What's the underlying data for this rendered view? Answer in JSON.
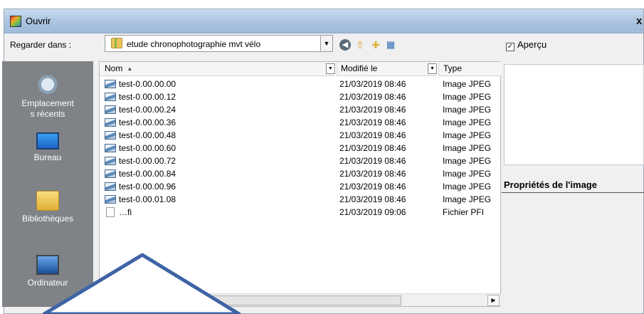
{
  "window": {
    "title": "Ouvrir",
    "close_glyph": "x"
  },
  "toolbar": {
    "look_in_label": "Regarder dans :",
    "location": "etude chronophotographie mvt vélo",
    "dropdown_glyph": "▼",
    "icons": [
      "back-icon",
      "up-folder-icon",
      "new-folder-icon",
      "view-menu-icon"
    ]
  },
  "preview": {
    "checkbox_label": "Aperçu",
    "checked": true,
    "check_glyph": "✓"
  },
  "places": [
    {
      "label_lines": [
        "Emplacement",
        "s récents"
      ],
      "icon": "recent-places-icon"
    },
    {
      "label_lines": [
        "Bureau"
      ],
      "icon": "desktop-icon"
    },
    {
      "label_lines": [
        "Bibliothèques"
      ],
      "icon": "libraries-icon"
    },
    {
      "label_lines": [
        "Ordinateur"
      ],
      "icon": "computer-icon"
    }
  ],
  "columns": {
    "name": "Nom",
    "modified": "Modifié le",
    "type": "Type",
    "sort_glyph": "▲",
    "dd_glyph": "▼"
  },
  "files": [
    {
      "name": "test-0.00.00.00",
      "modified": "21/03/2019 08:46",
      "type": "Image JPEG"
    },
    {
      "name": "test-0.00.00.12",
      "modified": "21/03/2019 08:46",
      "type": "Image JPEG"
    },
    {
      "name": "test-0.00.00.24",
      "modified": "21/03/2019 08:46",
      "type": "Image JPEG"
    },
    {
      "name": "test-0.00.00.36",
      "modified": "21/03/2019 08:46",
      "type": "Image JPEG"
    },
    {
      "name": "test-0.00.00.48",
      "modified": "21/03/2019 08:46",
      "type": "Image JPEG"
    },
    {
      "name": "test-0.00.00.60",
      "modified": "21/03/2019 08:46",
      "type": "Image JPEG"
    },
    {
      "name": "test-0.00.00.72",
      "modified": "21/03/2019 08:46",
      "type": "Image JPEG"
    },
    {
      "name": "test-0.00.00.84",
      "modified": "21/03/2019 08:46",
      "type": "Image JPEG"
    },
    {
      "name": "test-0.00.00.96",
      "modified": "21/03/2019 08:46",
      "type": "Image JPEG"
    },
    {
      "name": "test-0.00.01.08",
      "modified": "21/03/2019 08:46",
      "type": "Image JPEG"
    },
    {
      "name": "…fi",
      "modified": "21/03/2019 09:06",
      "type": "Fichier PFI"
    }
  ],
  "scrollbar": {
    "right_glyph": "▶"
  },
  "properties": {
    "title": "Propriétés de l'image"
  },
  "colors": {
    "titlebar": "#a9c3df",
    "places_panel": "#7f8387",
    "annotation_arrow": "#3f64a6"
  }
}
